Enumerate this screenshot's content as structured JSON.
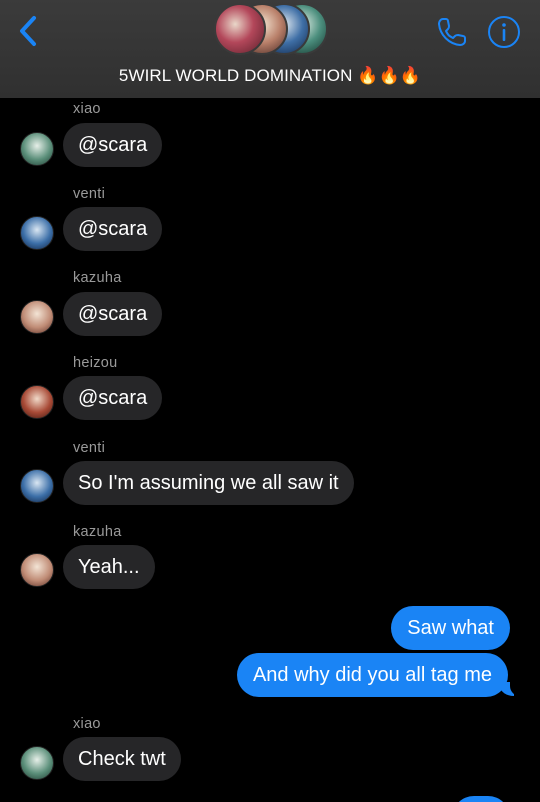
{
  "header": {
    "title": "5WIRL WORLD DOMINATION 🔥🔥🔥",
    "back_icon": "chevron-left-icon",
    "call_icon": "phone-icon",
    "info_icon": "info-icon",
    "accent_color": "#1a84f5"
  },
  "messages": [
    {
      "sender": "xiao",
      "text": "@scara",
      "direction": "in"
    },
    {
      "sender": "venti",
      "text": "@scara",
      "direction": "in"
    },
    {
      "sender": "kazuha",
      "text": "@scara",
      "direction": "in"
    },
    {
      "sender": "heizou",
      "text": "@scara",
      "direction": "in"
    },
    {
      "sender": "venti",
      "text": "So I'm assuming we all saw it",
      "direction": "in"
    },
    {
      "sender": "kazuha",
      "text": "Yeah...",
      "direction": "in"
    },
    {
      "text": "Saw what",
      "direction": "out"
    },
    {
      "text": "And why did you all tag me",
      "direction": "out"
    },
    {
      "sender": "xiao",
      "text": "Check twt",
      "direction": "in"
    }
  ]
}
